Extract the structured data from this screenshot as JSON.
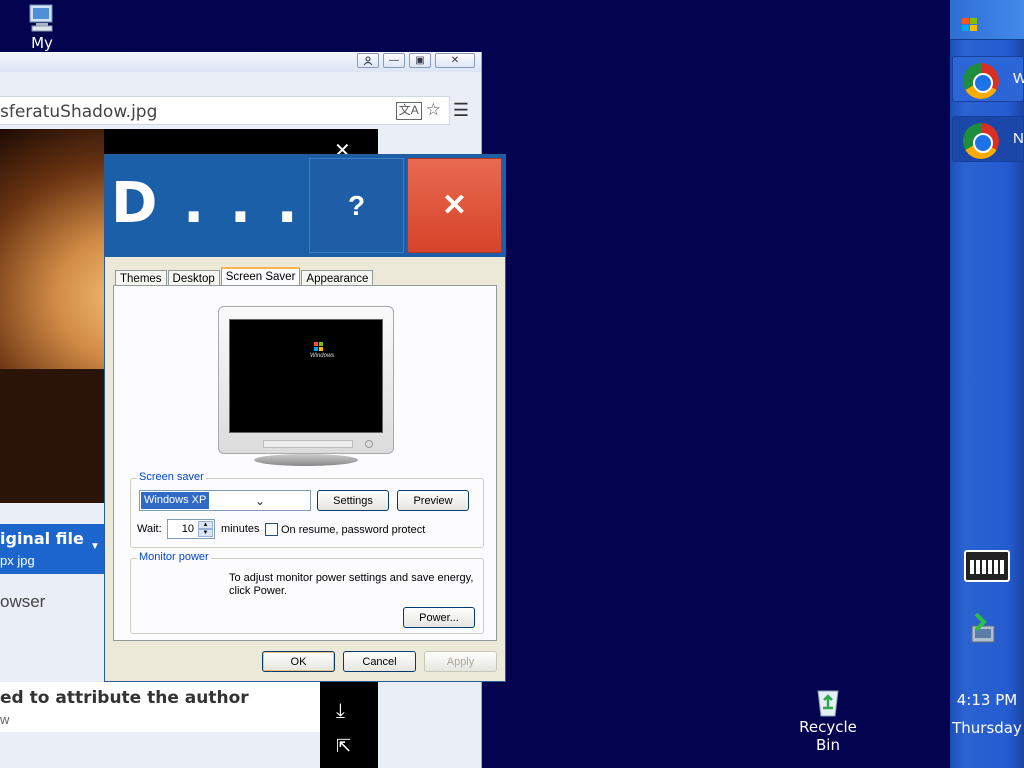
{
  "desktop": {
    "my_computer_label": "My",
    "recycle_bin_label_1": "Recycle",
    "recycle_bin_label_2": "Bin"
  },
  "browser": {
    "url_text": "sferatuShadow.jpg",
    "blue_bar_title": "iginal file",
    "blue_bar_sub": "px jpg",
    "browser_text": "owser",
    "attribution_title": "ed to attribute the author",
    "attribution_sub": "w"
  },
  "dialog": {
    "title": "D . . .",
    "help_label": "?",
    "close_label": "✕",
    "tabs": [
      {
        "label": "Themes"
      },
      {
        "label": "Desktop"
      },
      {
        "label": "Screen Saver",
        "active": true
      },
      {
        "label": "Appearance"
      }
    ],
    "screen_saver": {
      "group_label": "Screen saver",
      "selected": "Windows XP",
      "settings_label": "Settings",
      "preview_label": "Preview",
      "wait_label": "Wait:",
      "wait_value": "10",
      "minutes_label": "minutes",
      "password_label": "On resume, password protect",
      "password_checked": false
    },
    "monitor_power": {
      "group_label": "Monitor power",
      "description": "To adjust monitor power settings and save energy, click Power.",
      "power_label": "Power..."
    },
    "ok_label": "OK",
    "cancel_label": "Cancel",
    "apply_label": "Apply"
  },
  "taskbar": {
    "items": [
      {
        "label": "W",
        "icon": "chrome-icon"
      },
      {
        "label": "N",
        "icon": "chrome-icon",
        "active": true
      }
    ],
    "time": "4:13 PM",
    "day": "Thursday"
  }
}
